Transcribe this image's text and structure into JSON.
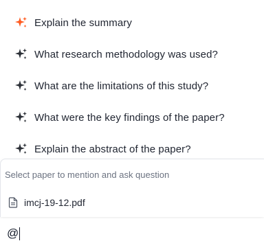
{
  "suggestions": [
    {
      "label": "Explain the summary",
      "icon": "sparkle-icon",
      "icon_color": "#ff5a1f"
    },
    {
      "label": "What research methodology was used?",
      "icon": "sparkle-icon",
      "icon_color": "#2b2f36"
    },
    {
      "label": "What are the limitations of this study?",
      "icon": "sparkle-icon",
      "icon_color": "#2b2f36"
    },
    {
      "label": "What were the key findings of the paper?",
      "icon": "sparkle-icon",
      "icon_color": "#2b2f36"
    },
    {
      "label": "Explain the abstract of the paper?",
      "icon": "sparkle-icon",
      "icon_color": "#2b2f36"
    }
  ],
  "mention": {
    "hint": "Select paper to mention and ask question",
    "files": [
      {
        "name": "imcj-19-12.pdf",
        "icon": "file-icon"
      }
    ]
  },
  "input": {
    "value": "@"
  }
}
